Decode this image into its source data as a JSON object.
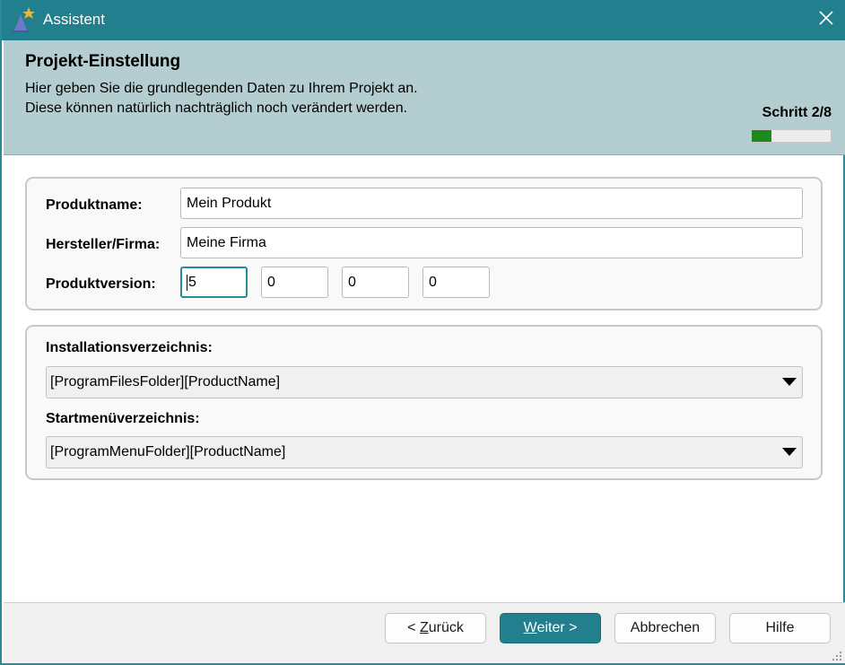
{
  "window": {
    "title": "Assistent",
    "accent": "#217f8e",
    "icon": "wizard-hat-star-icon",
    "close_icon": "close-icon"
  },
  "header": {
    "title": "Projekt-Einstellung",
    "desc_line1": "Hier geben Sie die grundlegenden Daten zu Ihrem Projekt an.",
    "desc_line2": "Diese können natürlich nachträglich noch verändert werden.",
    "step": "Schritt 2/8",
    "progress_fraction": 0.25,
    "progress_color": "#1e8a1e"
  },
  "product": {
    "name_label": "Produktname:",
    "name_value": "Mein Produkt",
    "vendor_label": "Hersteller/Firma:",
    "vendor_value": "Meine Firma",
    "version_label": "Produktversion:",
    "version_parts": [
      "5",
      "0",
      "0",
      "0"
    ]
  },
  "folders": {
    "install_label": "Installationsverzeichnis:",
    "install_value": "[ProgramFilesFolder][ProductName]",
    "startmenu_label": "Startmenüverzeichnis:",
    "startmenu_value": "[ProgramMenuFolder][ProductName]"
  },
  "footer": {
    "back_prefix": "< ",
    "back_mnemonic": "Z",
    "back_rest": "urück",
    "next_mnemonic": "W",
    "next_rest": "eiter >",
    "cancel_label": "Abbrechen",
    "help_label": "Hilfe"
  }
}
